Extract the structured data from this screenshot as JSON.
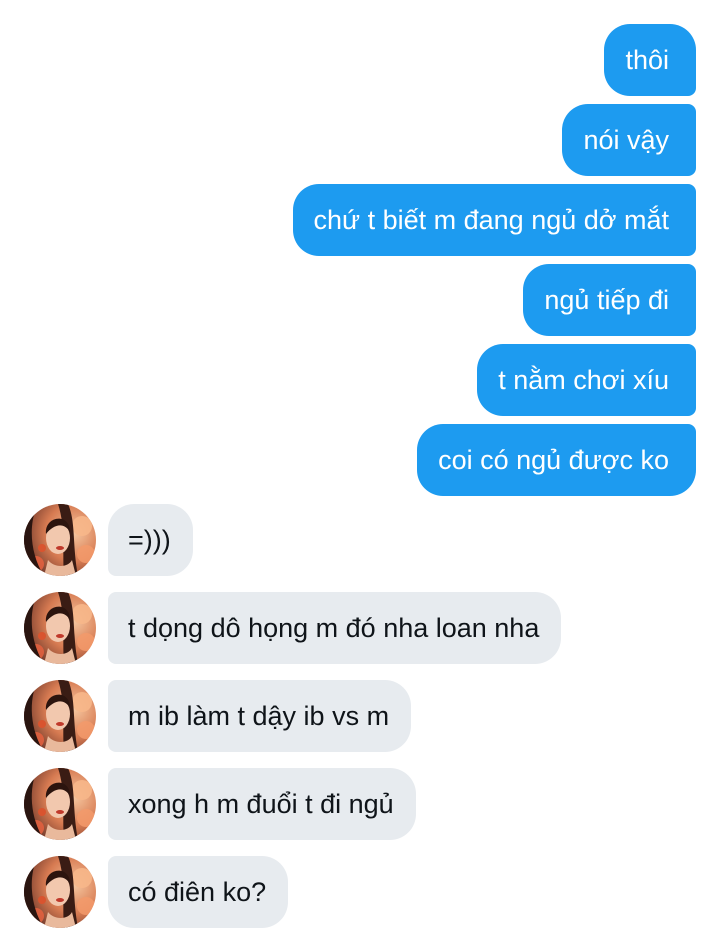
{
  "conversation": {
    "sent_messages": [
      {
        "text": "thôi"
      },
      {
        "text": "nói vậy"
      },
      {
        "text": "chứ t biết m đang ngủ dở mắt"
      },
      {
        "text": "ngủ tiếp đi"
      },
      {
        "text": "t nằm chơi xíu"
      },
      {
        "text": "coi có ngủ được ko"
      }
    ],
    "received_messages": [
      {
        "text": "=)))"
      },
      {
        "text": "t dọng dô họng m đó nha loan nha"
      },
      {
        "text": "m ib làm t dậy ib vs m"
      },
      {
        "text": "xong h m đuổi t đi ngủ"
      },
      {
        "text": "có điên ko?"
      }
    ]
  },
  "colors": {
    "sent_bubble": "#1d9bf0",
    "received_bubble": "#e7ebef",
    "sent_text": "#ffffff",
    "received_text": "#0f1419"
  },
  "icons": {
    "avatar": "contact-avatar-icon"
  }
}
